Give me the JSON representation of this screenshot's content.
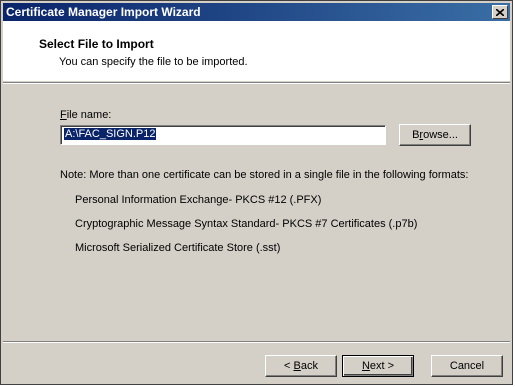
{
  "window": {
    "title": "Certificate Manager Import Wizard"
  },
  "header": {
    "title": "Select File to Import",
    "subtitle": "You can specify the file to be imported."
  },
  "file": {
    "label_mnemonic": "F",
    "label_rest": "ile name:",
    "value": "A:\\FAC_SIGN.P12"
  },
  "browse": {
    "mnemonic": "r",
    "prefix": "B",
    "rest": "owse..."
  },
  "note": "Note:  More than one certificate can be stored in a single file in the following formats:",
  "formats": [
    "Personal Information Exchange- PKCS #12 (.PFX)",
    "Cryptographic Message Syntax Standard- PKCS #7 Certificates (.p7b)",
    "Microsoft Serialized Certificate Store (.sst)"
  ],
  "buttons": {
    "back_prefix": "< ",
    "back_mnemonic": "B",
    "back_rest": "ack",
    "next_mnemonic": "N",
    "next_rest": "ext >",
    "cancel": "Cancel"
  }
}
